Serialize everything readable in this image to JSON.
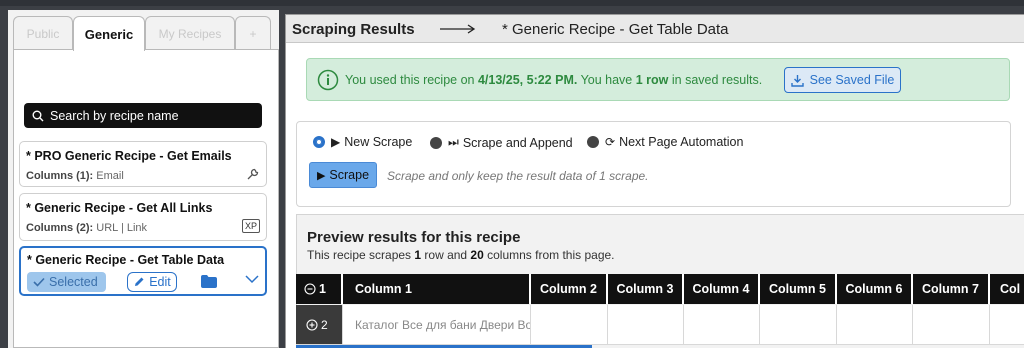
{
  "tabs": [
    "Public",
    "Generic",
    "My Recipes",
    "+"
  ],
  "search": {
    "placeholder": "Search by recipe name"
  },
  "recipes": [
    {
      "title": "* PRO Generic Recipe - Get Emails",
      "cols_label": "Columns (1):",
      "cols": "Email",
      "icon": "wrench-icon"
    },
    {
      "title": "* Generic Recipe - Get All Links",
      "cols_label": "Columns (2):",
      "cols": "URL | Link",
      "icon": "xp-badge",
      "badge": "XP"
    },
    {
      "title": "* Generic Recipe - Get Table Data",
      "selected_label": "Selected",
      "edit_label": "Edit"
    }
  ],
  "header": {
    "title": "Scraping Results",
    "recipe": "* Generic Recipe - Get Table Data"
  },
  "info": {
    "prefix": "You used this recipe on ",
    "date": "4/13/25, 5:22 PM.",
    "middle": " You have ",
    "rows": "1 row",
    "suffix": " in saved results.",
    "button": "See Saved File"
  },
  "options": {
    "new_scrape": "New Scrape",
    "scrape_append": "Scrape and Append",
    "next_page": "Next Page Automation",
    "scrape_button": "Scrape",
    "hint": "Scrape and only keep the result data of 1 scrape."
  },
  "preview": {
    "heading": "Preview results for this recipe",
    "sub_prefix": "This recipe scrapes ",
    "rows": "1",
    "sub_mid": " row and ",
    "cols": "20",
    "sub_suffix": " columns from this page."
  },
  "table": {
    "headers": [
      "1",
      "Column 1",
      "Column 2",
      "Column 3",
      "Column 4",
      "Column 5",
      "Column 6",
      "Column 7",
      "Col"
    ],
    "row": {
      "num": "2",
      "cell1": "Каталог Все для бани Двери Во"
    }
  },
  "colors": {
    "accent": "#2a72c9",
    "success_bg": "#d4eddc",
    "success_text": "#2d8a3f"
  }
}
